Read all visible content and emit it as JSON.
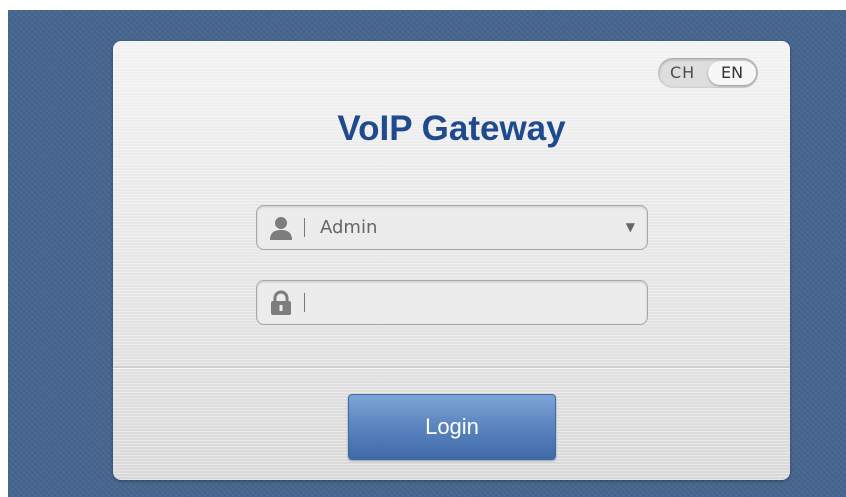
{
  "app": {
    "title": "VoIP Gateway"
  },
  "language": {
    "options": [
      "CH",
      "EN"
    ],
    "selected": "EN"
  },
  "login_form": {
    "username": {
      "icon": "user-icon",
      "value": "Admin"
    },
    "password": {
      "icon": "lock-icon",
      "value": "",
      "placeholder": ""
    },
    "submit_label": "Login"
  },
  "colors": {
    "title": "#1f4a8c",
    "button": "#5d87c0",
    "backdrop": "#47668f"
  }
}
